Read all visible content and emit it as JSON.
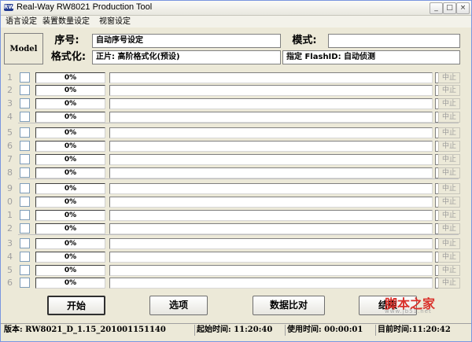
{
  "window": {
    "title": "Real-Way RW8021 Production Tool",
    "icon_label": "RW"
  },
  "controls": {
    "minimize": "_",
    "maximize": "□",
    "close": "×"
  },
  "menu": [
    "语言设定",
    "装置数量设定",
    "视窗设定"
  ],
  "header": {
    "model_label": "Model",
    "seq_label": "序号:",
    "seq_value": "自动序号设定",
    "mode_label": "模式:",
    "mode_value": "",
    "format_label": "格式化:",
    "format_value": "正片: 高阶格式化(预设)",
    "flash_value": "指定 FlashID: 自动侦测"
  },
  "rows": [
    {
      "num": "1",
      "pct": "0%",
      "progress": 0,
      "stop": "中止"
    },
    {
      "num": "2",
      "pct": "0%",
      "progress": 0,
      "stop": "中止"
    },
    {
      "num": "3",
      "pct": "0%",
      "progress": 0,
      "stop": "中止"
    },
    {
      "num": "4",
      "pct": "0%",
      "progress": 0,
      "stop": "中止"
    },
    {
      "num": "5",
      "pct": "0%",
      "progress": 0,
      "stop": "中止"
    },
    {
      "num": "6",
      "pct": "0%",
      "progress": 0,
      "stop": "中止"
    },
    {
      "num": "7",
      "pct": "0%",
      "progress": 0,
      "stop": "中止"
    },
    {
      "num": "8",
      "pct": "0%",
      "progress": 0,
      "stop": "中止"
    },
    {
      "num": "9",
      "pct": "0%",
      "progress": 0,
      "stop": "中止"
    },
    {
      "num": "0",
      "pct": "0%",
      "progress": 0,
      "stop": "中止"
    },
    {
      "num": "1",
      "pct": "0%",
      "progress": 0,
      "stop": "中止"
    },
    {
      "num": "2",
      "pct": "0%",
      "progress": 0,
      "stop": "中止"
    },
    {
      "num": "3",
      "pct": "0%",
      "progress": 0,
      "stop": "中止"
    },
    {
      "num": "4",
      "pct": "0%",
      "progress": 0,
      "stop": "中止"
    },
    {
      "num": "5",
      "pct": "0%",
      "progress": 0,
      "stop": "中止"
    },
    {
      "num": "6",
      "pct": "0%",
      "progress": 0,
      "stop": "中止"
    }
  ],
  "buttons": {
    "start": "开始",
    "options": "选项",
    "compare": "数据比对",
    "exit": "结束"
  },
  "status": {
    "version": "版本: RW8021_D_1.15_201001151140",
    "start_time": "起始时间: 11:20:40",
    "used_time": "使用时间: 00:00:01",
    "current_time": "目前时间:11:20:42"
  },
  "watermark": {
    "text": "脚本之家",
    "sub": "www.jb51.net"
  }
}
